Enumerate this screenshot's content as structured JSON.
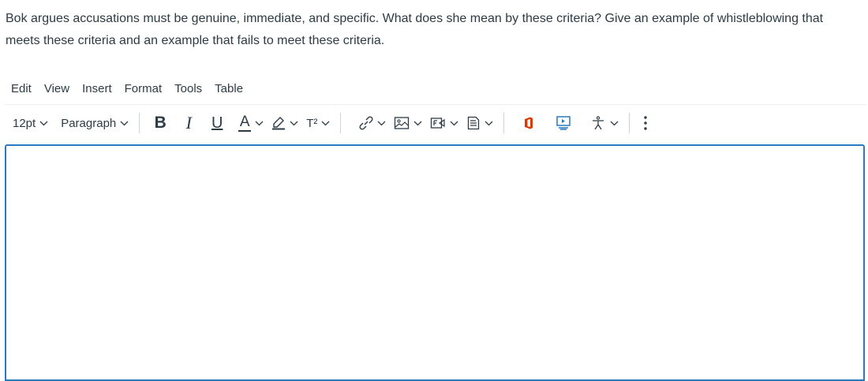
{
  "question": {
    "text": "Bok argues accusations must be genuine, immediate, and specific.  What does she mean by these criteria?  Give an example of whistleblowing that meets these criteria and an example that fails to meet these criteria."
  },
  "menubar": {
    "items": [
      "Edit",
      "View",
      "Insert",
      "Format",
      "Tools",
      "Table"
    ]
  },
  "toolbar": {
    "font_size": "12pt",
    "block_format": "Paragraph",
    "bold_label": "B",
    "italic_label": "I",
    "underline_label": "U",
    "text_color_label": "A",
    "superscript_label": "T²",
    "icons": [
      "chevron-down-icon",
      "highlighter-icon",
      "link-icon",
      "image-icon",
      "media-icon",
      "document-icon",
      "office-icon",
      "apps-icon",
      "accessibility-icon",
      "more-icon"
    ],
    "colors": {
      "text_color_underline": "#2d3b45",
      "office": "#d83b01",
      "apps": "#2b7abc",
      "editor_border": "#2b7abc"
    }
  },
  "editor": {
    "content": ""
  }
}
